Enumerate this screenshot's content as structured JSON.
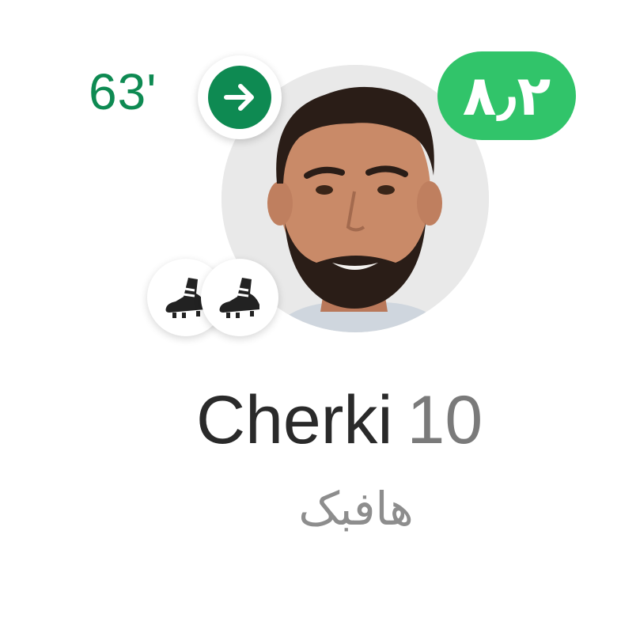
{
  "player": {
    "sub_in_time": "63'",
    "rating": "۸٫۲",
    "name": "Cherki",
    "number": "10",
    "position": "هافبک",
    "goals": 2
  },
  "colors": {
    "sub_badge": "#0e8a52",
    "rating_badge": "#31c46a",
    "name_text": "#2a2a2a",
    "number_text": "#7a7a7a",
    "position_text": "#8d8d8d",
    "avatar_bg": "#e9e9e9"
  },
  "icons": {
    "sub_in": "arrow-right-icon",
    "goal": "football-boot-icon",
    "avatar": "player-photo"
  }
}
